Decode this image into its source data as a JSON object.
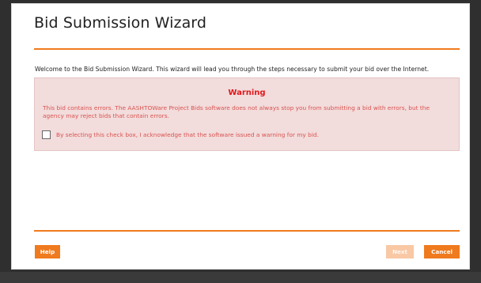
{
  "wizard": {
    "title": "Bid Submission Wizard",
    "intro": "Welcome to the Bid Submission Wizard. This wizard will lead you through the steps necessary to submit your bid over the Internet."
  },
  "warning": {
    "title": "Warning",
    "message": "This bid contains errors. The AASHTOWare Project Bids software does not always stop you from submitting a bid with errors, but the agency may reject bids that contain errors.",
    "acknowledge_label": "By selecting this check box, I acknowledge that the software issued a warning for my bid.",
    "acknowledge_checked": false
  },
  "buttons": {
    "help": "Help",
    "next": "Next",
    "cancel": "Cancel"
  },
  "colors": {
    "accent": "#f07a1e",
    "warning_red": "#e0181b",
    "warning_background": "#f2dcdc"
  }
}
